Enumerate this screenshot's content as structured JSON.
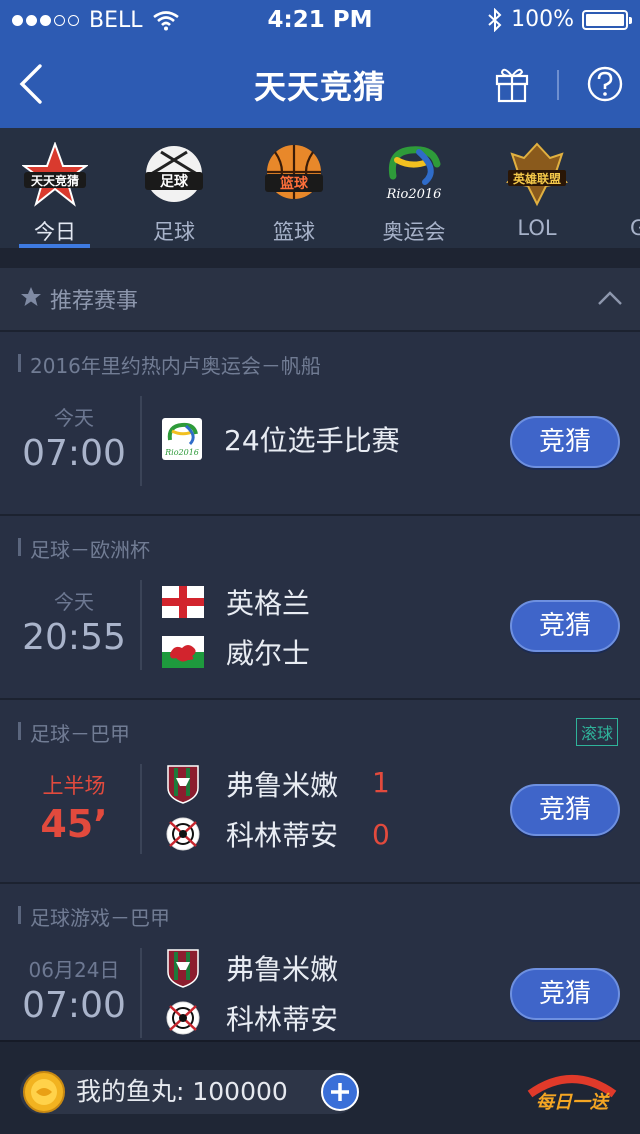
{
  "status": {
    "carrier": "BELL",
    "time": "4:21 PM",
    "battery": "100%"
  },
  "nav": {
    "title": "天天竞猜"
  },
  "categories": [
    {
      "label": "今日",
      "logo": "天天竞猜"
    },
    {
      "label": "足球",
      "logo": "足球"
    },
    {
      "label": "篮球",
      "logo": "篮球"
    },
    {
      "label": "奥运会",
      "logo": "Rio2016"
    },
    {
      "label": "LOL",
      "logo": "英雄联盟"
    },
    {
      "label": "G"
    }
  ],
  "section": {
    "label": "推荐赛事"
  },
  "matches": [
    {
      "header": "2016年里约热内卢奥运会－帆船",
      "day": "今天",
      "time": "07:00",
      "team1": "24位选手比赛",
      "button": "竞猜"
    },
    {
      "header": "足球－欧洲杯",
      "day": "今天",
      "time": "20:55",
      "team1": "英格兰",
      "team2": "威尔士",
      "button": "竞猜"
    },
    {
      "header": "足球－巴甲",
      "tag": "滚球",
      "day": "上半场",
      "time": "45’",
      "team1": "弗鲁米嫩",
      "score1": "1",
      "team2": "科林蒂安",
      "score2": "0",
      "button": "竞猜"
    },
    {
      "header": "足球游戏－巴甲",
      "day": "06月24日",
      "time": "07:00",
      "team1": "弗鲁米嫩",
      "team2": "科林蒂安",
      "button": "竞猜"
    }
  ],
  "footer": {
    "coins_label": "我的鱼丸: 100000",
    "daily_label": "每日一送"
  },
  "colors": {
    "navbar": "#2d5bb3",
    "background": "#252c3b",
    "button": "#3f65c9",
    "live": "#e24a3d",
    "tag": "#2fb39a"
  }
}
